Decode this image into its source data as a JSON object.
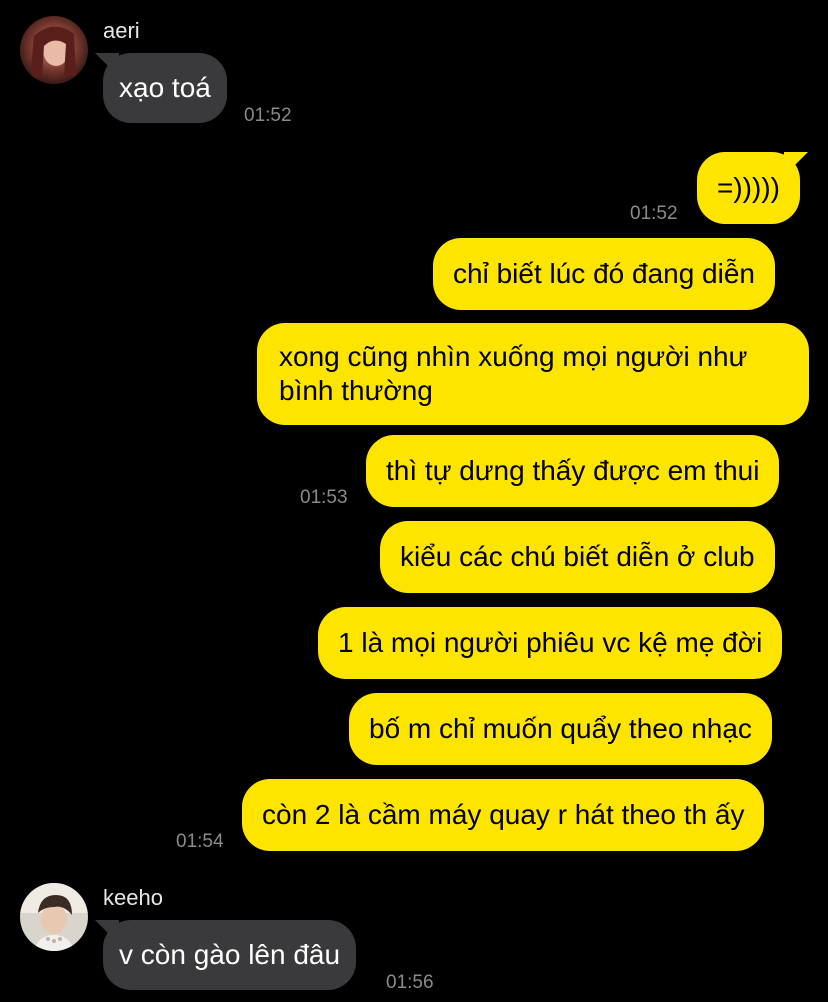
{
  "colors": {
    "background": "#000000",
    "incoming_bubble": "#3a3a3c",
    "outgoing_bubble": "#fee500",
    "timestamp": "#8a8a8e"
  },
  "messages": {
    "aeri": {
      "sender": "aeri",
      "text": "xạo toá",
      "time": "01:52"
    },
    "out1": {
      "text": "=)))))",
      "time": "01:52"
    },
    "out2": {
      "text": "chỉ biết lúc đó đang diễn"
    },
    "out3": {
      "text": "xong cũng nhìn xuống mọi người như bình thường"
    },
    "out4": {
      "text": "thì tự dưng thấy được em thui",
      "time": "01:53"
    },
    "out5": {
      "text": "kiểu các chú biết diễn ở club"
    },
    "out6": {
      "text": "1 là mọi người phiêu vc kệ mẹ đời"
    },
    "out7": {
      "text": "bố m chỉ muốn quẩy theo nhạc"
    },
    "out8": {
      "text": "còn 2 là cầm máy quay r hát theo th ấy",
      "time": "01:54"
    },
    "keeho": {
      "sender": "keeho",
      "text": "v còn gào lên đâu",
      "time": "01:56"
    }
  }
}
